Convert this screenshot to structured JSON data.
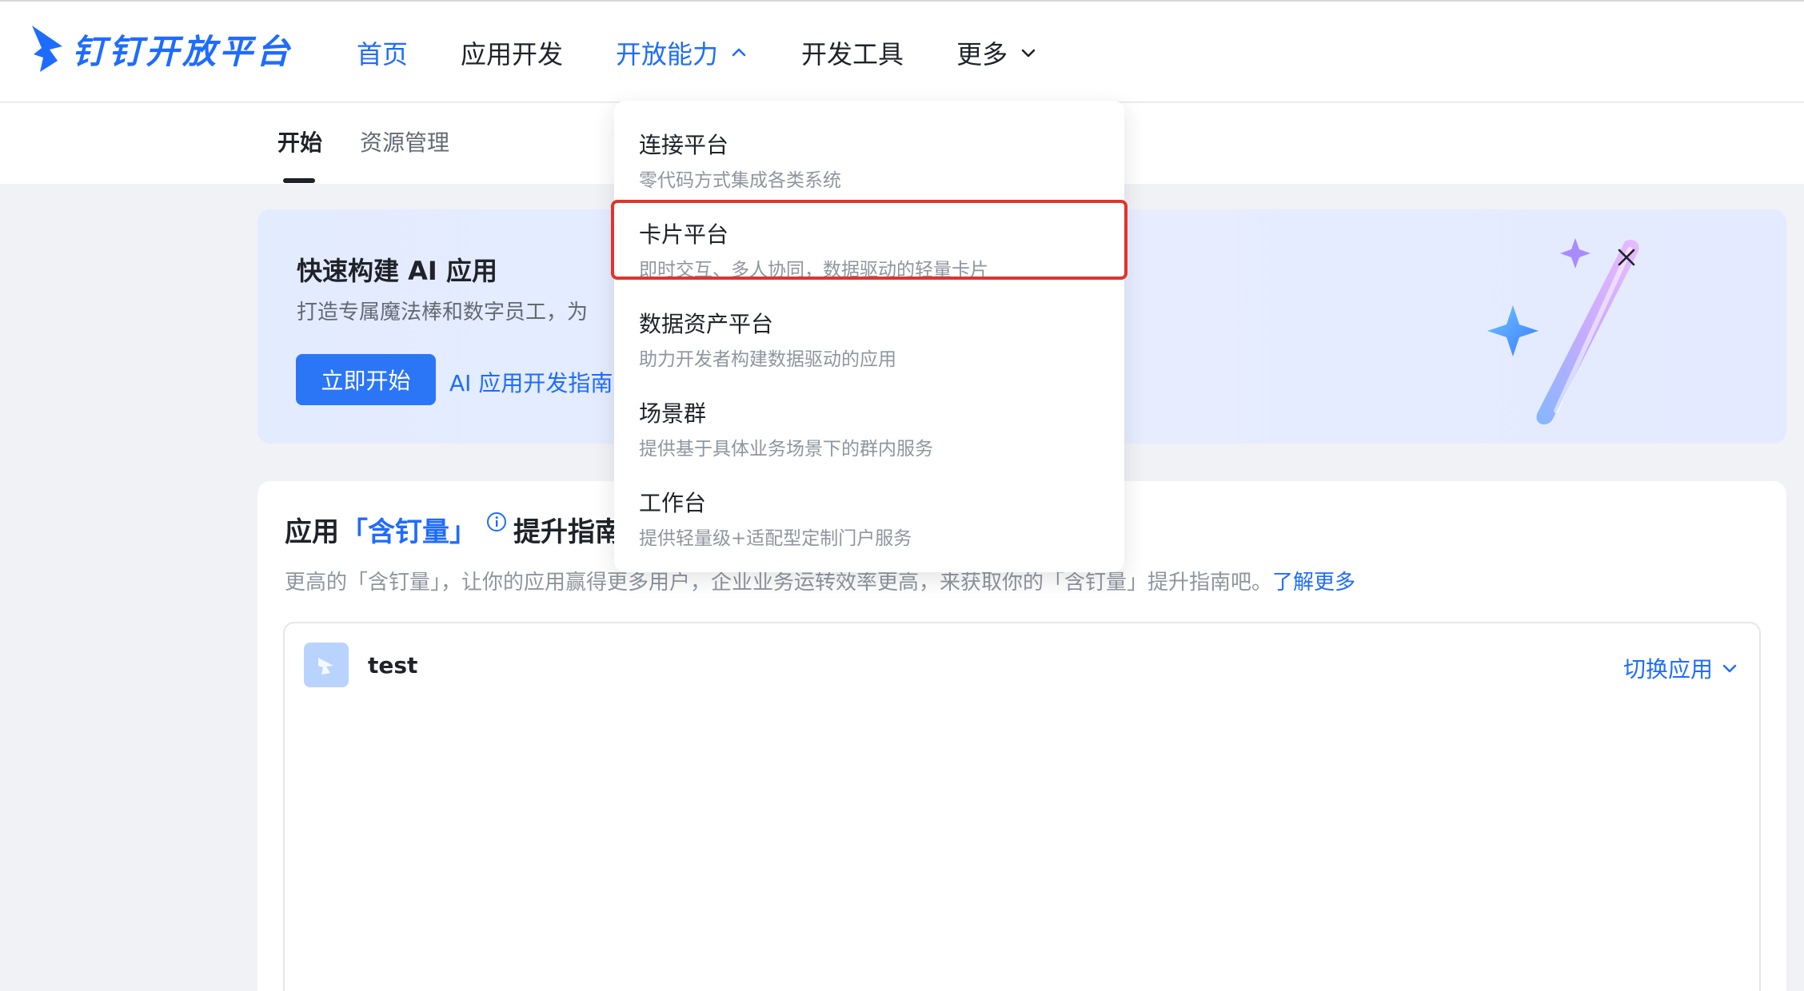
{
  "brand": {
    "name": "钉钉开放平台"
  },
  "nav": {
    "items": [
      {
        "label": "首页",
        "active": true,
        "chevron": ""
      },
      {
        "label": "应用开发",
        "active": false,
        "chevron": ""
      },
      {
        "label": "开放能力",
        "active": true,
        "chevron": "chevron-up-icon"
      },
      {
        "label": "开发工具",
        "active": false,
        "chevron": ""
      },
      {
        "label": "更多",
        "active": false,
        "chevron": "chevron-down-icon"
      }
    ]
  },
  "subnav": {
    "tabs": [
      {
        "label": "开始",
        "active": true
      },
      {
        "label": "资源管理",
        "active": false
      }
    ]
  },
  "banner": {
    "title": "快速构建 AI 应用",
    "desc": "打造专属魔法棒和数字员工，为",
    "cta": "立即开始",
    "link": "AI 应用开发指南"
  },
  "card": {
    "title_prefix": "应用",
    "title_highlight": "「含钉量」",
    "title_suffix": "提升指南",
    "desc": "更高的「含钉量」，让你的应用赢得更多用户，企业业务运转效率更高，来获取你的「含钉量」提升指南吧。",
    "more": "了解更多",
    "app_name": "test",
    "switch_label": "切换应用"
  },
  "dropdown": {
    "items": [
      {
        "title": "连接平台",
        "desc": "零代码方式集成各类系统"
      },
      {
        "title": "卡片平台",
        "desc": "即时交互、多人协同，数据驱动的轻量卡片"
      },
      {
        "title": "数据资产平台",
        "desc": "助力开发者构建数据驱动的应用"
      },
      {
        "title": "场景群",
        "desc": "提供基于具体业务场景下的群内服务"
      },
      {
        "title": "工作台",
        "desc": "提供轻量级+适配型定制门户服务"
      }
    ]
  },
  "colors": {
    "brand": "#1e6cff",
    "primary_button": "#2b76f6",
    "highlight": "#e0342e"
  }
}
